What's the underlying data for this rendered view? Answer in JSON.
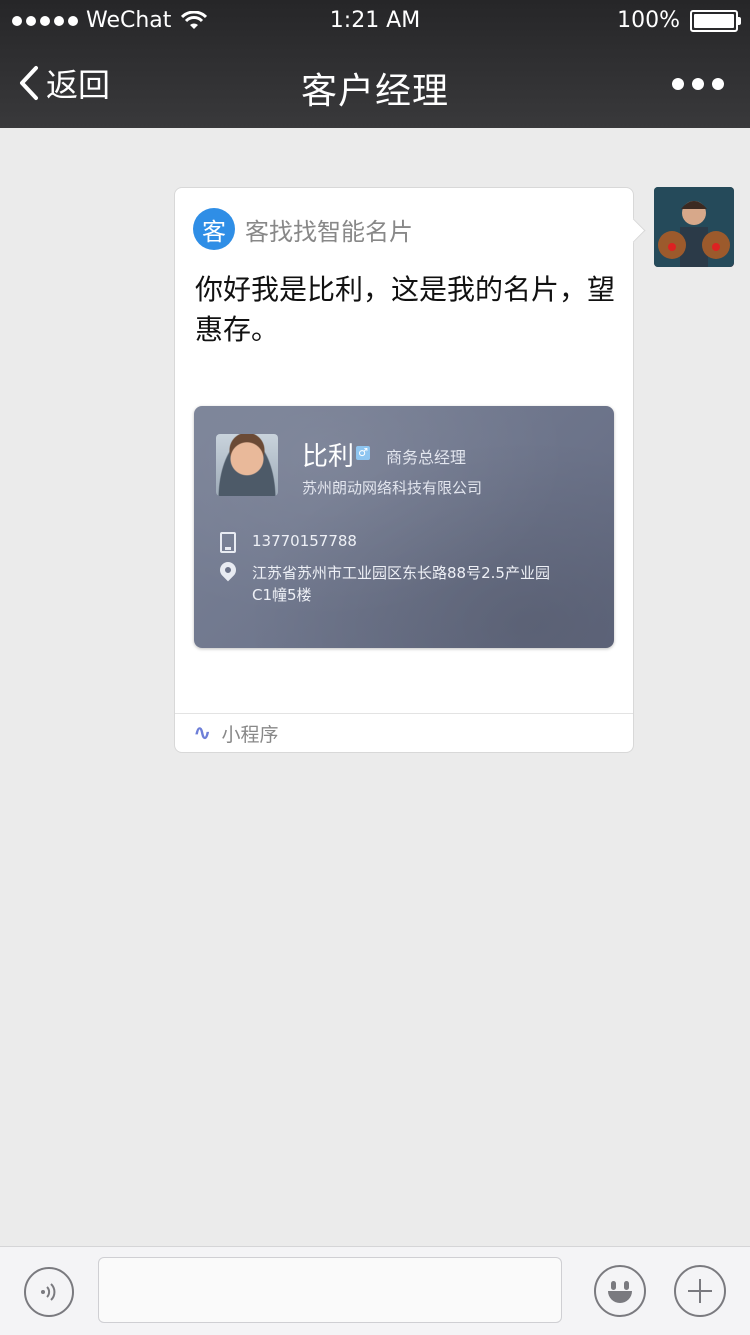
{
  "status_bar": {
    "carrier": "WeChat",
    "time": "1:21 AM",
    "battery": "100%"
  },
  "nav": {
    "back_label": "返回",
    "title": "客户经理"
  },
  "message": {
    "mini_program_logo_char": "客",
    "mini_program_name": "客找找智能名片",
    "text": "你好我是比利，这是我的名片，望惠存。",
    "footer_label": "小程序"
  },
  "business_card": {
    "name": "比利",
    "gender_symbol": "♂",
    "job_title": "商务总经理",
    "company": "苏州朗动网络科技有限公司",
    "phone": "13770157788",
    "address": "江苏省苏州市工业园区东长路88号2.5产业园C1幢5楼"
  },
  "icons": {
    "back": "chevron-left-icon",
    "more": "more-icon",
    "phone": "phone-icon",
    "location": "location-pin-icon",
    "mini_program": "link-icon",
    "voice": "voice-icon",
    "emoji": "emoji-icon",
    "plus": "plus-icon"
  },
  "colors": {
    "nav_bg": "#2f2f31",
    "chat_bg": "#ebebeb",
    "card_bg": "#6f768c",
    "mp_logo": "#2f8ee6"
  }
}
